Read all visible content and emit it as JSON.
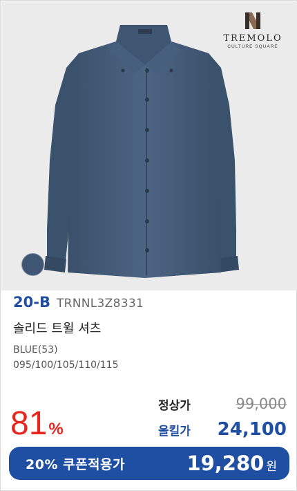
{
  "brand_logo": {
    "name": "TREMOLO",
    "sub": "CULTURE SQUARE"
  },
  "product": {
    "brand_code": "20-B",
    "product_code": "TRNNL3Z8331",
    "name": "솔리드 트윌 셔츠",
    "color": "BLUE(53)",
    "sizes": "095/100/105/110/115",
    "swatch_color": "#3f5774"
  },
  "discount": {
    "rate": "81",
    "unit": "%"
  },
  "pricing": {
    "regular_label": "정상가",
    "regular_price": "99,000",
    "sale_label": "올킬가",
    "sale_price": "24,100"
  },
  "coupon": {
    "label": "20% 쿠폰적용가",
    "price": "19,280",
    "unit": "원"
  },
  "colors": {
    "accent_blue": "#1e4fa3",
    "discount_red": "#e8251e",
    "shirt_blue": "#3f5774"
  }
}
